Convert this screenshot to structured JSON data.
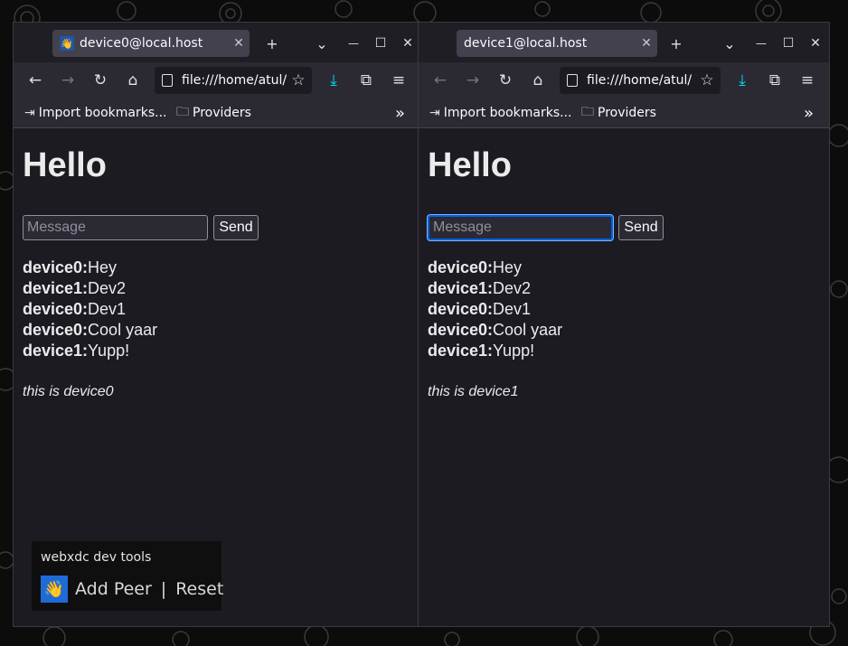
{
  "windows": [
    {
      "tab": {
        "favicon": "waving-hand-icon",
        "title": "device0@local.host",
        "close": "✕"
      },
      "url": "file:///home/atul/",
      "bookmarks": {
        "import": "Import bookmarks...",
        "providers": "Providers",
        "overflow": "»"
      },
      "page": {
        "heading": "Hello",
        "input": {
          "placeholder": "Message",
          "value": "",
          "focused": false
        },
        "send_label": "Send",
        "messages": [
          {
            "sender": "device0:",
            "text": "Hey"
          },
          {
            "sender": "device1:",
            "text": "Dev2"
          },
          {
            "sender": "device0:",
            "text": "Dev1"
          },
          {
            "sender": "device0:",
            "text": "Cool yaar"
          },
          {
            "sender": "device1:",
            "text": "Yupp!"
          }
        ],
        "device_note": "this is device0"
      },
      "devtools": {
        "title": "webxdc dev tools",
        "add_peer": "Add Peer",
        "separator": "|",
        "reset": "Reset"
      }
    },
    {
      "tab": {
        "title": "device1@local.host",
        "close": "✕"
      },
      "url": "file:///home/atul/",
      "bookmarks": {
        "import": "Import bookmarks...",
        "providers": "Providers",
        "overflow": "»"
      },
      "page": {
        "heading": "Hello",
        "input": {
          "placeholder": "Message",
          "value": "",
          "focused": true
        },
        "send_label": "Send",
        "messages": [
          {
            "sender": "device0:",
            "text": "Hey"
          },
          {
            "sender": "device1:",
            "text": "Dev2"
          },
          {
            "sender": "device0:",
            "text": "Dev1"
          },
          {
            "sender": "device0:",
            "text": "Cool yaar"
          },
          {
            "sender": "device1:",
            "text": "Yupp!"
          }
        ],
        "device_note": "this is device1"
      }
    }
  ],
  "window_controls": {
    "new_tab": "+",
    "list_tabs": "⌄",
    "minimize": "—",
    "maximize": "☐",
    "close": "✕"
  },
  "nav_icons": {
    "back": "←",
    "forward": "→",
    "reload": "↻",
    "home": "⌂",
    "bookmark": "☆",
    "downloads": "⤓",
    "extensions": "⧉",
    "menu": "≡"
  },
  "colors": {
    "accent": "#0060df",
    "download_icon": "#54ffbd",
    "page_bg": "#1c1b22",
    "toolbar_bg": "#2b2a33"
  }
}
